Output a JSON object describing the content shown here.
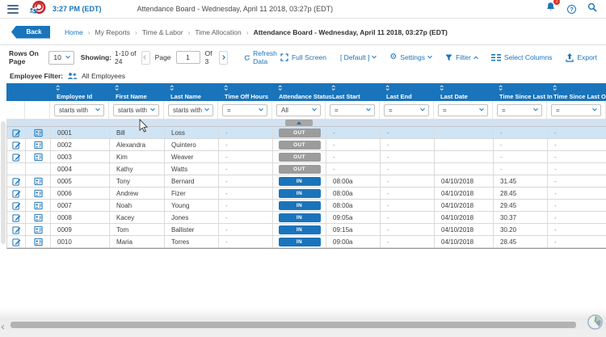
{
  "topbar": {
    "time": "3:27 PM (EDT)",
    "title": "Attendance Board - Wednesday, April 11 2018, 03:27p (EDT)",
    "notification_badge": "1"
  },
  "breadcrumb": {
    "back": "Back",
    "items": [
      "Home",
      "My Reports",
      "Time & Labor",
      "Time Allocation"
    ],
    "current": "Attendance Board - Wednesday, April 11 2018, 03:27p (EDT)"
  },
  "toolbar": {
    "rows_on_page_label": "Rows On Page",
    "rows_per_page": "10",
    "showing_label": "Showing:",
    "showing_value": "1-10 of 24",
    "page_label": "Page",
    "page_number": "1",
    "of_label": "Of 3",
    "refresh": "Refresh Data",
    "full_screen": "Full Screen",
    "default_view": "[ Default ]",
    "settings": "Settings",
    "filter": "Filter",
    "select_columns": "Select Columns",
    "export": "Export"
  },
  "employee_filter": {
    "label": "Employee Filter:",
    "value": "All Employees"
  },
  "table": {
    "columns": [
      "Employee Id",
      "First Name",
      "Last Name",
      "Time Off Hours",
      "Attendance Status",
      "Last Start",
      "Last End",
      "Last Date",
      "Time Since Last In",
      "Time Since Last Out"
    ],
    "filter_row": [
      "starts with",
      "starts with",
      "starts with",
      "=",
      "All",
      "=",
      "=",
      "=",
      "=",
      "="
    ],
    "rows": [
      {
        "employee_id": "0001",
        "first_name": "Bill",
        "last_name": "Loss",
        "time_off_hours": "-",
        "attendance_status": "OUT",
        "last_start": "-",
        "last_end": "-",
        "last_date": "",
        "time_since_last_in": "-",
        "time_since_last_out": "-",
        "has_icons": true,
        "selected": true
      },
      {
        "employee_id": "0002",
        "first_name": "Alexandra",
        "last_name": "Quintero",
        "time_off_hours": "-",
        "attendance_status": "OUT",
        "last_start": "-",
        "last_end": "-",
        "last_date": "",
        "time_since_last_in": "-",
        "time_since_last_out": "-",
        "has_icons": true,
        "selected": false
      },
      {
        "employee_id": "0003",
        "first_name": "Kim",
        "last_name": "Weaver",
        "time_off_hours": "-",
        "attendance_status": "OUT",
        "last_start": "-",
        "last_end": "-",
        "last_date": "",
        "time_since_last_in": "-",
        "time_since_last_out": "-",
        "has_icons": true,
        "selected": false
      },
      {
        "employee_id": "0004",
        "first_name": "Kathy",
        "last_name": "Watts",
        "time_off_hours": "-",
        "attendance_status": "OUT",
        "last_start": "-",
        "last_end": "-",
        "last_date": "",
        "time_since_last_in": "-",
        "time_since_last_out": "-",
        "has_icons": false,
        "selected": false
      },
      {
        "employee_id": "0005",
        "first_name": "Tony",
        "last_name": "Bernard",
        "time_off_hours": "-",
        "attendance_status": "IN",
        "last_start": "08:00a",
        "last_end": "-",
        "last_date": "04/10/2018",
        "time_since_last_in": "31.45",
        "time_since_last_out": "-",
        "has_icons": true,
        "selected": false
      },
      {
        "employee_id": "0006",
        "first_name": "Andrew",
        "last_name": "Fizer",
        "time_off_hours": "-",
        "attendance_status": "IN",
        "last_start": "08:00a",
        "last_end": "-",
        "last_date": "04/10/2018",
        "time_since_last_in": "28.45",
        "time_since_last_out": "-",
        "has_icons": true,
        "selected": false
      },
      {
        "employee_id": "0007",
        "first_name": "Noah",
        "last_name": "Young",
        "time_off_hours": "-",
        "attendance_status": "IN",
        "last_start": "08:00a",
        "last_end": "-",
        "last_date": "04/10/2018",
        "time_since_last_in": "29.45",
        "time_since_last_out": "-",
        "has_icons": true,
        "selected": false
      },
      {
        "employee_id": "0008",
        "first_name": "Kacey",
        "last_name": "Jones",
        "time_off_hours": "-",
        "attendance_status": "IN",
        "last_start": "09:05a",
        "last_end": "-",
        "last_date": "04/10/2018",
        "time_since_last_in": "30.37",
        "time_since_last_out": "-",
        "has_icons": true,
        "selected": false
      },
      {
        "employee_id": "0009",
        "first_name": "Tom",
        "last_name": "Ballister",
        "time_off_hours": "-",
        "attendance_status": "IN",
        "last_start": "09:15a",
        "last_end": "-",
        "last_date": "04/10/2018",
        "time_since_last_in": "30.20",
        "time_since_last_out": "-",
        "has_icons": true,
        "selected": false
      },
      {
        "employee_id": "0010",
        "first_name": "Maria",
        "last_name": "Torres",
        "time_off_hours": "-",
        "attendance_status": "IN",
        "last_start": "09:00a",
        "last_end": "-",
        "last_date": "04/10/2018",
        "time_since_last_in": "28.45",
        "time_since_last_out": "-",
        "has_icons": true,
        "selected": false
      }
    ]
  },
  "icons": {
    "menu": "hamburger",
    "bell": "notifications",
    "help": "?",
    "search": "magnifier",
    "refresh": "circular-arrow",
    "full_screen": "expand-corners",
    "settings": "gear",
    "filter": "funnel",
    "select_columns": "column-lines",
    "export": "up-arrow-tray",
    "edit_row": "pencil-document",
    "employee_card": "person-card",
    "sort": "up-down-chevrons"
  },
  "colors": {
    "primary_blue": "#1a74bb",
    "status_out_gray": "#9c9c9c",
    "selected_row": "#cfe4f5",
    "badge_red": "#d9342b",
    "logo_red": "#c9252b"
  }
}
